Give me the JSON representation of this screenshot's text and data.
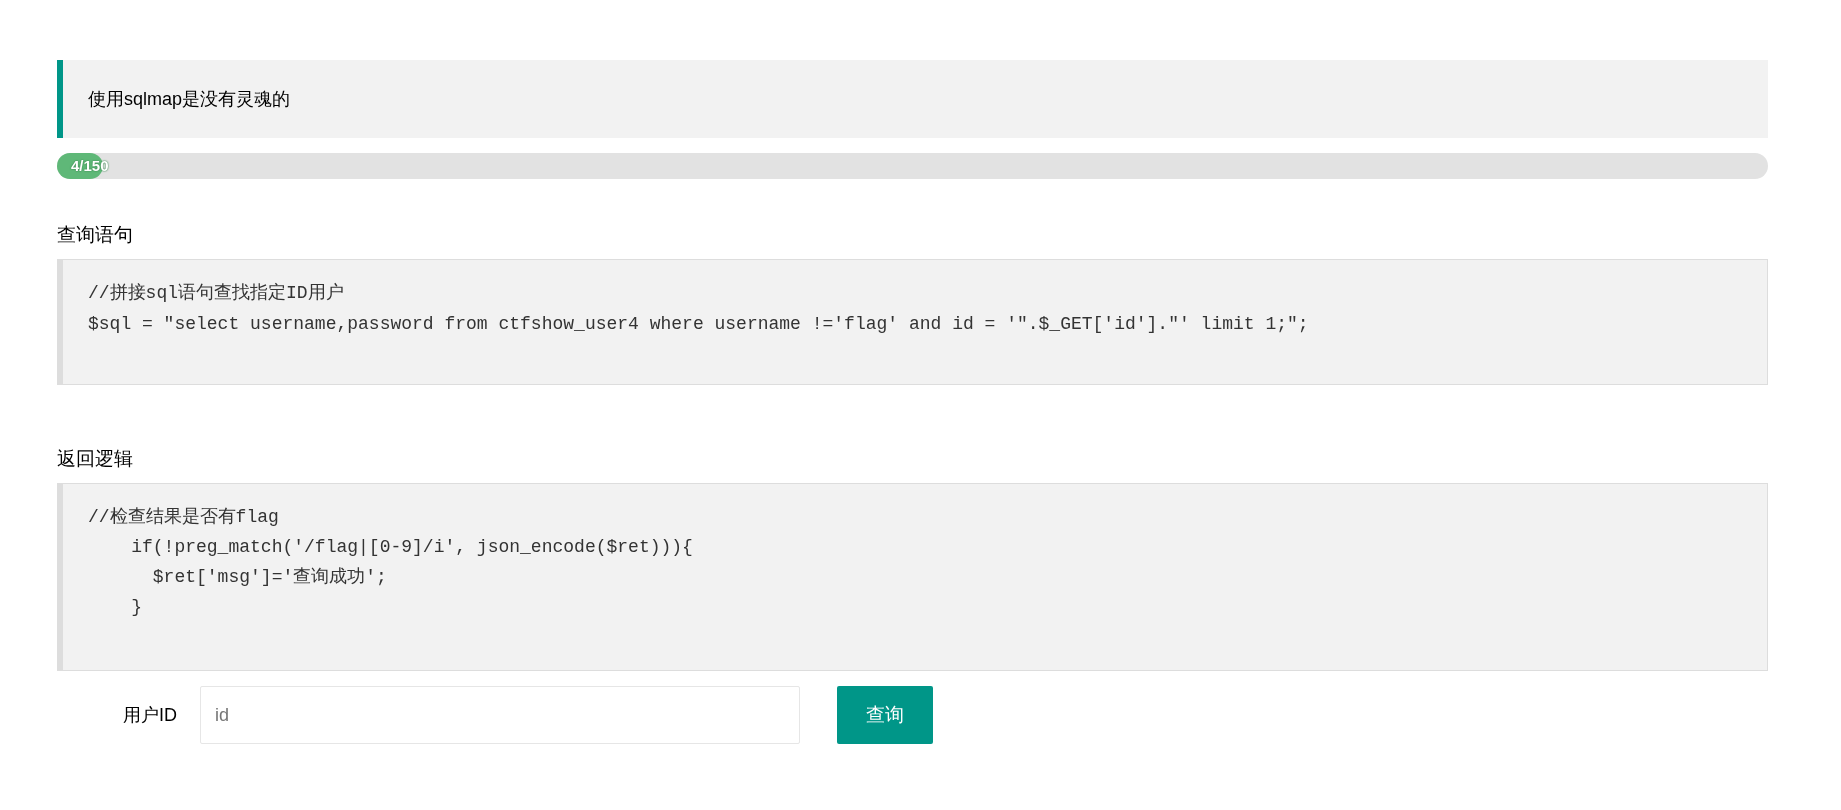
{
  "notice": {
    "text": "使用sqlmap是没有灵魂的"
  },
  "progress": {
    "label": "4/150",
    "level": 0.027
  },
  "sections": [
    {
      "heading": "查询语句",
      "code": [
        "//拼接sql语句查找指定ID用户",
        "$sql = \"select username,password from ctfshow_user4 where username !='flag' and id = '\".$_GET['id'].\"' limit 1;\";"
      ]
    },
    {
      "heading": "返回逻辑",
      "code": [
        "//检查结果是否有flag",
        "    if(!preg_match('/flag|[0-9]/i', json_encode($ret))){",
        "      $ret['msg']='查询成功';",
        "    }"
      ]
    }
  ],
  "form": {
    "label": "用户ID",
    "input": {
      "placeholder": "id"
    },
    "button": "查询"
  }
}
